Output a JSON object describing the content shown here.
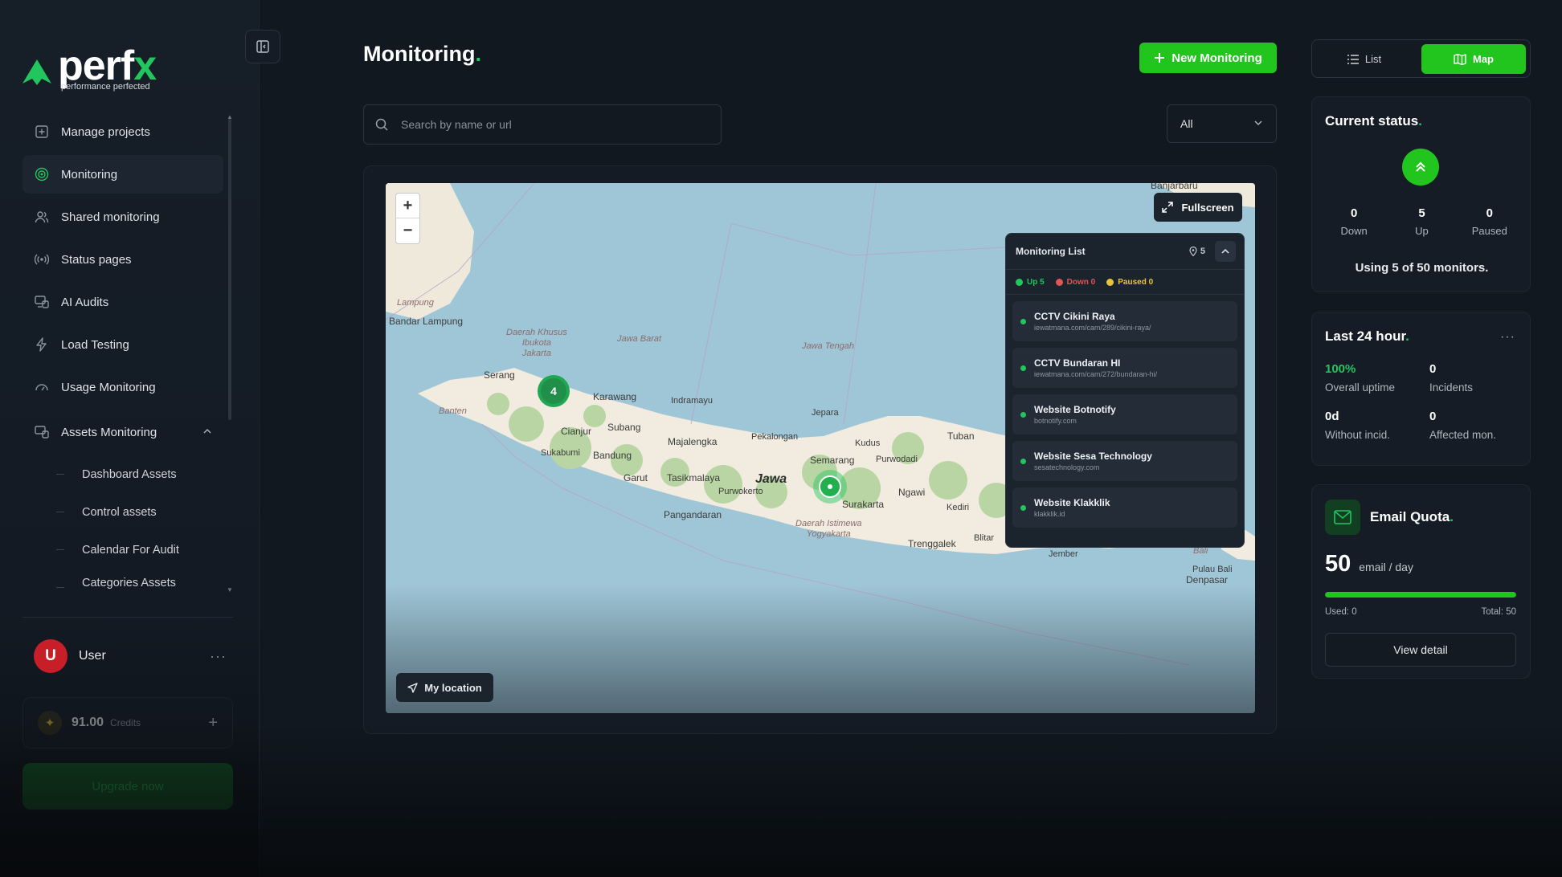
{
  "brand": {
    "name_main": "perf",
    "name_accent": "x",
    "tagline": "performance perfected"
  },
  "sidebar": {
    "items": [
      {
        "label": "Manage projects",
        "icon": "plus-square-icon"
      },
      {
        "label": "Monitoring",
        "icon": "radar-icon",
        "active": true
      },
      {
        "label": "Shared monitoring",
        "icon": "users-icon"
      },
      {
        "label": "Status pages",
        "icon": "broadcast-icon"
      },
      {
        "label": "AI Audits",
        "icon": "monitor-icon"
      },
      {
        "label": "Load Testing",
        "icon": "lightning-icon"
      },
      {
        "label": "Usage Monitoring",
        "icon": "gauge-icon"
      },
      {
        "label": "Assets Monitoring",
        "icon": "devices-icon",
        "expanded": true
      }
    ],
    "sub_items": [
      {
        "label": "Dashboard Assets"
      },
      {
        "label": "Control assets"
      },
      {
        "label": "Calendar For Audit"
      },
      {
        "label": "Categories Assets"
      }
    ],
    "user": {
      "initial": "U",
      "name": "User",
      "more": "···"
    },
    "credits": {
      "value": "91.00",
      "label": "Credits",
      "add": "+"
    },
    "upgrade_label": "Upgrade now"
  },
  "header": {
    "title": "Monitoring",
    "title_dot": ".",
    "new_button": "New Monitoring",
    "view_list": "List",
    "view_map": "Map"
  },
  "search": {
    "placeholder": "Search by name or url",
    "value": ""
  },
  "filter": {
    "selected": "All"
  },
  "map": {
    "fullscreen_label": "Fullscreen",
    "my_location_label": "My location",
    "zoom_in": "+",
    "zoom_out": "−",
    "cluster_count": "4",
    "labels": {
      "banjarbaru": "Banjarbaru",
      "lampung": "Lampung",
      "bandar_lampung": "Bandar Lampung",
      "dki": "Daerah Khusus\nIbukota\nJakarta",
      "jawa_barat": "Jawa Barat",
      "jawa_tengah": "Jawa Tengah",
      "serang": "Serang",
      "banten": "Banten",
      "karawang": "Karawang",
      "indramayu": "Indramayu",
      "cianjur": "Cianjur",
      "subang": "Subang",
      "sukabumi": "Sukabumi",
      "bandung": "Bandung",
      "majalengka": "Majalengka",
      "pekalongan": "Pekalongan",
      "jepara": "Jepara",
      "kudus": "Kudus",
      "tuban": "Tuban",
      "semarang": "Semarang",
      "purwodadi": "Purwodadi",
      "garut": "Garut",
      "tasikmalaya": "Tasikmalaya",
      "jawa": "Jawa",
      "purwokerto": "Purwokerto",
      "ngawi": "Ngawi",
      "surakarta": "Surakarta",
      "kediri": "Kediri",
      "pangandaran": "Pangandaran",
      "diy": "Daerah Istimewa\nYogyakarta",
      "trenggalek": "Trenggalek",
      "blitar": "Blitar",
      "jember": "Jember",
      "bali": "Bali",
      "pulau_bali": "Pulau Bali",
      "denpasar": "Denpasar"
    }
  },
  "monitoring_list": {
    "title": "Monitoring List",
    "count": "5",
    "legend": {
      "up": "Up 5",
      "down": "Down 0",
      "paused": "Paused 0"
    },
    "items": [
      {
        "name": "CCTV Cikini Raya",
        "url": "iewatmana.com/cam/289/cikini-raya/"
      },
      {
        "name": "CCTV Bundaran HI",
        "url": "iewatmana.com/cam/272/bundaran-hi/"
      },
      {
        "name": "Website Botnotify",
        "url": "botnotify.com"
      },
      {
        "name": "Website Sesa Technology",
        "url": "sesatechnology.com"
      },
      {
        "name": "Website Klakklik",
        "url": "klakklik.id"
      }
    ]
  },
  "current_status": {
    "title": "Current status",
    "down": "0",
    "down_label": "Down",
    "up": "5",
    "up_label": "Up",
    "paused": "0",
    "paused_label": "Paused",
    "note": "Using 5 of 50 monitors."
  },
  "last24": {
    "title": "Last 24 hour",
    "more": "···",
    "uptime": "100%",
    "uptime_label": "Overall uptime",
    "incidents": "0",
    "incidents_label": "Incidents",
    "without": "0d",
    "without_label": "Without incid.",
    "affected": "0",
    "affected_label": "Affected mon."
  },
  "email_quota": {
    "title": "Email Quota",
    "amount": "50",
    "unit": "email / day",
    "used": "Used: 0",
    "total": "Total: 50",
    "fill_fraction": 1.0,
    "button": "View detail"
  },
  "colors": {
    "accent": "#22c51e",
    "bg": "#111820",
    "card": "#151c25",
    "down": "#e05555",
    "paused": "#e8c43a"
  }
}
